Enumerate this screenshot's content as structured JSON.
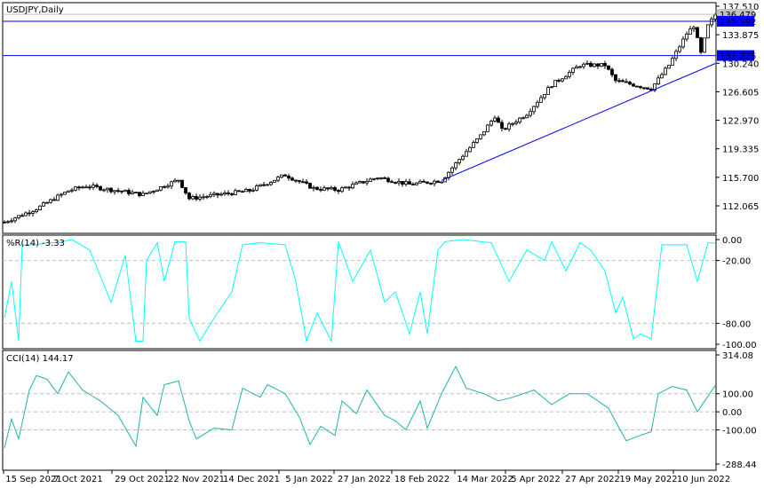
{
  "symbol_title": "USDJPY,Daily",
  "colors": {
    "line": "#0000ff",
    "indicator": "#00ffff",
    "cci": "#20b2aa",
    "label_bg": "#0000ff",
    "ask_bg": "#c0c0c0"
  },
  "price_axis": {
    "ticks": [
      "137.510",
      "133.875",
      "130.240",
      "126.605",
      "122.970",
      "119.335",
      "115.700",
      "112.065"
    ],
    "tick_values": [
      137.51,
      133.875,
      130.24,
      126.605,
      122.97,
      119.335,
      115.7,
      112.065
    ]
  },
  "price_labels": {
    "ask": "136.479",
    "level1": "135.592",
    "level2": "131.225"
  },
  "levels": [
    135.592,
    131.225
  ],
  "wpr": {
    "title": "%R(14) -3.33",
    "ticks": [
      "0.00",
      "-20.00",
      "-80.00",
      "-100.00"
    ],
    "tick_values": [
      0,
      -20,
      -80,
      -100
    ]
  },
  "cci": {
    "title": "CCI(14) 144.17",
    "ticks": [
      "314.08",
      "100.00",
      "0.00",
      "-100.00",
      "-288.44"
    ],
    "tick_values": [
      314.08,
      100,
      0,
      -100,
      -288.44
    ]
  },
  "x_axis": [
    "15 Sep 2021",
    "7 Oct 2021",
    "29 Oct 2021",
    "22 Nov 2021",
    "14 Dec 2021",
    "5 Jan 2022",
    "27 Jan 2022",
    "18 Feb 2022",
    "14 Mar 2022",
    "5 Apr 2022",
    "27 Apr 2022",
    "19 May 2022",
    "10 Jun 2022"
  ],
  "chart_data": {
    "type": "candlestick",
    "bars": 200,
    "price_close_anchors": [
      [
        0,
        110.0
      ],
      [
        9,
        111.7
      ],
      [
        18,
        114.0
      ],
      [
        23,
        114.6
      ],
      [
        39,
        113.5
      ],
      [
        49,
        115.4
      ],
      [
        52,
        113.0
      ],
      [
        69,
        114.0
      ],
      [
        79,
        116.0
      ],
      [
        87,
        114.3
      ],
      [
        94,
        114.1
      ],
      [
        105,
        115.7
      ],
      [
        114,
        114.8
      ],
      [
        123,
        115.3
      ],
      [
        128,
        118.0
      ],
      [
        134,
        121.0
      ],
      [
        138,
        123.5
      ],
      [
        140,
        121.7
      ],
      [
        147,
        123.8
      ],
      [
        154,
        127.5
      ],
      [
        162,
        130.0
      ],
      [
        169,
        130.0
      ],
      [
        172,
        128.0
      ],
      [
        182,
        127.0
      ],
      [
        187,
        130.0
      ],
      [
        192,
        134.0
      ],
      [
        194,
        135.0
      ],
      [
        196,
        131.5
      ],
      [
        198,
        135.0
      ],
      [
        200,
        136.4
      ]
    ],
    "trendline": [
      [
        123,
        115.3
      ],
      [
        200,
        130.2
      ]
    ],
    "wpr_anchors": [
      [
        0,
        -75
      ],
      [
        2,
        -40
      ],
      [
        4,
        -97
      ],
      [
        5,
        -5
      ],
      [
        9,
        -5
      ],
      [
        12,
        -3
      ],
      [
        15,
        -3
      ],
      [
        19,
        0
      ],
      [
        24,
        -10
      ],
      [
        27,
        -35
      ],
      [
        30,
        -60
      ],
      [
        34,
        -15
      ],
      [
        37,
        -97
      ],
      [
        39,
        -97
      ],
      [
        40,
        -20
      ],
      [
        43,
        -3
      ],
      [
        45,
        -40
      ],
      [
        48,
        -2
      ],
      [
        51,
        -2
      ],
      [
        52,
        -75
      ],
      [
        55,
        -97
      ],
      [
        59,
        -75
      ],
      [
        64,
        -50
      ],
      [
        67,
        -5
      ],
      [
        72,
        -3
      ],
      [
        79,
        -5
      ],
      [
        82,
        -40
      ],
      [
        85,
        -97
      ],
      [
        88,
        -70
      ],
      [
        92,
        -97
      ],
      [
        94,
        -2
      ],
      [
        98,
        -40
      ],
      [
        103,
        -10
      ],
      [
        107,
        -60
      ],
      [
        110,
        -50
      ],
      [
        114,
        -90
      ],
      [
        117,
        -50
      ],
      [
        119,
        -90
      ],
      [
        122,
        -10
      ],
      [
        124,
        -2
      ],
      [
        129,
        0
      ],
      [
        137,
        -3
      ],
      [
        142,
        -40
      ],
      [
        147,
        -10
      ],
      [
        152,
        -20
      ],
      [
        154,
        -2
      ],
      [
        158,
        -30
      ],
      [
        162,
        -3
      ],
      [
        165,
        -10
      ],
      [
        169,
        -30
      ],
      [
        172,
        -70
      ],
      [
        174,
        -55
      ],
      [
        177,
        -95
      ],
      [
        179,
        -90
      ],
      [
        182,
        -95
      ],
      [
        185,
        -5
      ],
      [
        188,
        -5
      ],
      [
        192,
        -5
      ],
      [
        195,
        -40
      ],
      [
        198,
        -3
      ],
      [
        200,
        -3.33
      ]
    ],
    "cci_anchors": [
      [
        0,
        -200
      ],
      [
        2,
        -40
      ],
      [
        4,
        -150
      ],
      [
        7,
        120
      ],
      [
        9,
        200
      ],
      [
        12,
        180
      ],
      [
        15,
        100
      ],
      [
        18,
        220
      ],
      [
        22,
        120
      ],
      [
        27,
        60
      ],
      [
        32,
        -20
      ],
      [
        37,
        -190
      ],
      [
        39,
        80
      ],
      [
        43,
        -20
      ],
      [
        45,
        150
      ],
      [
        49,
        170
      ],
      [
        52,
        -50
      ],
      [
        54,
        -150
      ],
      [
        59,
        -90
      ],
      [
        64,
        -100
      ],
      [
        67,
        130
      ],
      [
        72,
        80
      ],
      [
        74,
        150
      ],
      [
        79,
        100
      ],
      [
        83,
        -30
      ],
      [
        86,
        -180
      ],
      [
        89,
        -80
      ],
      [
        93,
        -130
      ],
      [
        95,
        60
      ],
      [
        99,
        -10
      ],
      [
        102,
        120
      ],
      [
        107,
        -20
      ],
      [
        110,
        -50
      ],
      [
        113,
        -100
      ],
      [
        117,
        60
      ],
      [
        119,
        -90
      ],
      [
        123,
        100
      ],
      [
        127,
        250
      ],
      [
        130,
        130
      ],
      [
        135,
        100
      ],
      [
        139,
        60
      ],
      [
        143,
        80
      ],
      [
        149,
        120
      ],
      [
        154,
        40
      ],
      [
        159,
        100
      ],
      [
        164,
        100
      ],
      [
        170,
        20
      ],
      [
        173,
        -90
      ],
      [
        175,
        -160
      ],
      [
        179,
        -130
      ],
      [
        182,
        -110
      ],
      [
        184,
        100
      ],
      [
        188,
        140
      ],
      [
        192,
        120
      ],
      [
        195,
        0
      ],
      [
        200,
        144.17
      ]
    ]
  }
}
